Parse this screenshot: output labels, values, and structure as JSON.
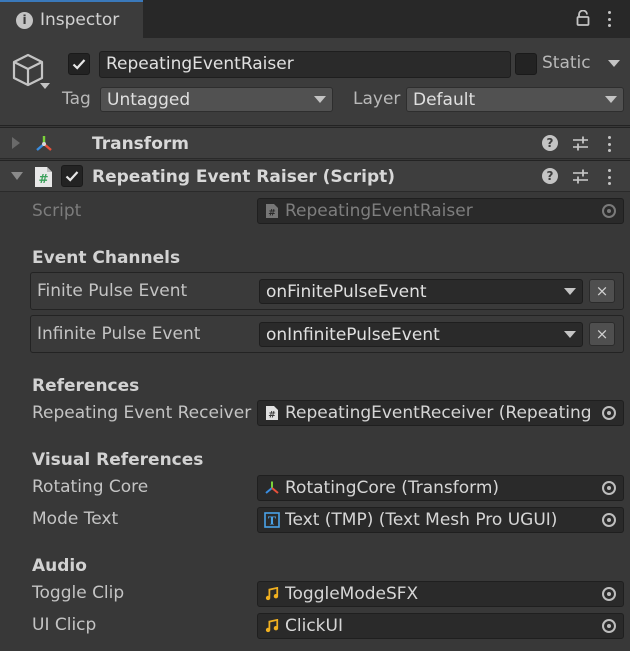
{
  "tab": {
    "title": "Inspector"
  },
  "gameobject": {
    "active": true,
    "name": "RepeatingEventRaiser",
    "static_label": "Static",
    "tag_label": "Tag",
    "tag_value": "Untagged",
    "layer_label": "Layer",
    "layer_value": "Default"
  },
  "components": [
    {
      "title": "Transform",
      "expanded": false
    },
    {
      "title": "Repeating Event Raiser (Script)",
      "expanded": true,
      "enabled": true
    }
  ],
  "script_field": {
    "label": "Script",
    "value": "RepeatingEventRaiser"
  },
  "event_channels": {
    "header": "Event Channels",
    "items": [
      {
        "label": "Finite Pulse Event",
        "value": "onFinitePulseEvent"
      },
      {
        "label": "Infinite Pulse Event",
        "value": "onInfinitePulseEvent"
      }
    ],
    "remove_label": "×"
  },
  "references": {
    "header": "References",
    "items": [
      {
        "label": "Repeating Event Receiver",
        "value": "RepeatingEventReceiver (Repeating E"
      }
    ]
  },
  "visual_references": {
    "header": "Visual References",
    "items": [
      {
        "label": "Rotating Core",
        "value": "RotatingCore (Transform)",
        "icon": "transform-icon"
      },
      {
        "label": "Mode Text",
        "value": "Text (TMP) (Text Mesh Pro UGUI)",
        "icon": "text-tmp-icon"
      }
    ]
  },
  "audio": {
    "header": "Audio",
    "items": [
      {
        "label": "Toggle Clip",
        "value": "ToggleModeSFX",
        "icon": "audio-clip-icon"
      },
      {
        "label": "UI Clicp",
        "value": "ClickUI",
        "icon": "audio-clip-icon"
      }
    ]
  },
  "colors": {
    "background": "#383838",
    "accent": "#3a79bb",
    "text": "#c4c4c4"
  }
}
